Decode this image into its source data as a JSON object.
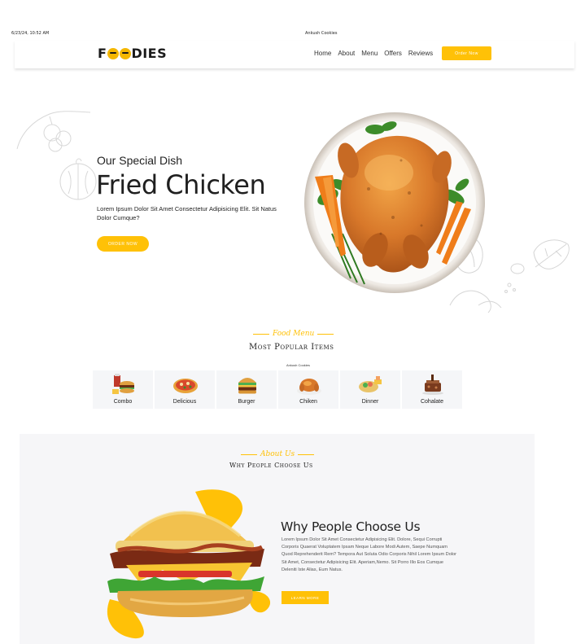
{
  "print_header": {
    "date": "6/23/24, 10:52 AM",
    "title": "Ankush Cookies"
  },
  "brand": {
    "logo_prefix": "F",
    "logo_suffix": "DIES"
  },
  "nav": {
    "links": [
      "Home",
      "About",
      "Menu",
      "Offers",
      "Reviews"
    ],
    "cta": "Order Now"
  },
  "hero": {
    "subtitle": "Our Special Dish",
    "title": "Fried Chicken",
    "description": "Lorem Ipsum Dolor Sit Amet Consectetur Adipisicing Elit. Sit Natus Dolor Cumque?",
    "button": "ORDER NOW"
  },
  "menu_section": {
    "tag": "Food Menu",
    "heading": "Most Popular Items",
    "small_label": "Ankush Cookies",
    "items": [
      {
        "label": "Combo",
        "icon": "combo-icon"
      },
      {
        "label": "Delicious",
        "icon": "pizza-icon"
      },
      {
        "label": "Burger",
        "icon": "burger-icon"
      },
      {
        "label": "Chiken",
        "icon": "chicken-icon"
      },
      {
        "label": "Dinner",
        "icon": "dinner-icon"
      },
      {
        "label": "Cohalate",
        "icon": "chocolate-icon"
      }
    ]
  },
  "about_section": {
    "tag": "About Us",
    "heading": "Why People Choose Us",
    "title": "Why People Choose Us",
    "description": "Lorem Ipsum Dolor Sit Amet Consectetur Adipisicing Elit. Dolore, Sequi Corrupti Corporis Quaerat Voluptatem Ipsam Neque Labore Modi Autem, Saepe Numquam Quod Reprehenderit Rem? Tempora Aut Soluta Odio Corporis Nihil Lorem Ipsum Dolor Sit Amet, Consectetur Adipisicing Elit. Aperiam,Nemo. Sit Porro Illo Eos Cumque Deleniti Iste Alias, Eum Natus.",
    "button": "LEARN MORE"
  },
  "colors": {
    "accent": "#ffc107",
    "text": "#1f1f1f",
    "section_bg": "#f6f6f8"
  }
}
